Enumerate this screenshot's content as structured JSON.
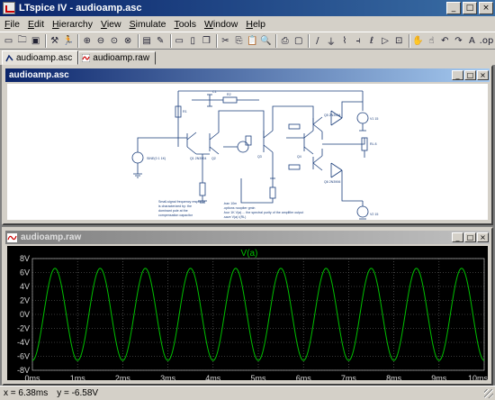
{
  "app": {
    "title": "LTspice IV - audioamp.asc",
    "window_buttons": [
      "_",
      "□",
      "×"
    ]
  },
  "menu": [
    {
      "accel": "F",
      "rest": "ile"
    },
    {
      "accel": "E",
      "rest": "dit"
    },
    {
      "accel": "H",
      "rest": "ierarchy"
    },
    {
      "accel": "V",
      "rest": "iew"
    },
    {
      "accel": "S",
      "rest": "imulate"
    },
    {
      "accel": "T",
      "rest": "ools"
    },
    {
      "accel": "W",
      "rest": "indow"
    },
    {
      "accel": "H",
      "rest": "elp"
    }
  ],
  "toolbar": {
    "icons": [
      "open-icon",
      "folder-icon",
      "save-icon",
      "sep",
      "settings-icon",
      "run-icon",
      "sep",
      "zoom-in-icon",
      "zoom-out-icon",
      "zoom-fit-icon",
      "zoom-cancel-icon",
      "sep",
      "autorange-icon",
      "probe-icon",
      "sep",
      "tile-horizontal-icon",
      "tile-vertical-icon",
      "cascade-icon",
      "sep",
      "cut-icon",
      "copy-icon",
      "paste-icon",
      "find-icon",
      "sep",
      "print-icon",
      "print-preview-icon",
      "sep",
      "wire-icon",
      "ground-icon",
      "resistor-icon",
      "capacitor-icon",
      "inductor-icon",
      "diode-icon",
      "component-icon",
      "sep",
      "move-icon",
      "drag-icon",
      "undo-icon",
      "redo-icon",
      "text-icon",
      "spice-directive-icon"
    ],
    "glyphs": {
      "open-icon": "▭",
      "folder-icon": "🗀",
      "save-icon": "▣",
      "settings-icon": "⚒",
      "run-icon": "🏃",
      "zoom-in-icon": "⊕",
      "zoom-out-icon": "⊖",
      "zoom-fit-icon": "⊙",
      "zoom-cancel-icon": "⊗",
      "autorange-icon": "▤",
      "probe-icon": "✎",
      "tile-horizontal-icon": "▭",
      "tile-vertical-icon": "▯",
      "cascade-icon": "❐",
      "cut-icon": "✂",
      "copy-icon": "⎘",
      "paste-icon": "📋",
      "find-icon": "🔍",
      "print-icon": "⎙",
      "print-preview-icon": "▢",
      "wire-icon": "/",
      "ground-icon": "⏚",
      "resistor-icon": "⌇",
      "capacitor-icon": "⫞",
      "inductor-icon": "ℓ",
      "diode-icon": "▷",
      "component-icon": "⊡",
      "move-icon": "✋",
      "drag-icon": "☝",
      "undo-icon": "↶",
      "redo-icon": "↷",
      "text-icon": "A",
      "spice-directive-icon": ".op"
    }
  },
  "tabs": [
    {
      "label": "audioamp.asc",
      "active": true
    },
    {
      "label": "audioamp.raw",
      "active": false
    }
  ],
  "schematic_window": {
    "title": "audioamp.asc"
  },
  "waveform_window": {
    "title": "audioamp.raw",
    "trace_label": "V(a)"
  },
  "chart_data": {
    "type": "line",
    "title": "V(a)",
    "xlabel": "",
    "ylabel": "",
    "x_ticks": [
      "0ms",
      "1ms",
      "2ms",
      "3ms",
      "4ms",
      "5ms",
      "6ms",
      "7ms",
      "8ms",
      "9ms",
      "10ms"
    ],
    "y_ticks": [
      "8V",
      "6V",
      "4V",
      "2V",
      "0V",
      "-2V",
      "-4V",
      "-6V",
      "-8V"
    ],
    "xlim": [
      0,
      10
    ],
    "ylim": [
      -8,
      8
    ],
    "grid": true,
    "series": [
      {
        "name": "V(a)",
        "color": "#00c000",
        "amplitude": 6.6,
        "frequency_khz": 1.0,
        "phase_deg": 180
      }
    ],
    "background": "#000000"
  },
  "status": {
    "x": "x = 6.38ms",
    "y": "y = -6.58V"
  },
  "colors": {
    "title_active": "#0a246a",
    "trace": "#00c000",
    "grid": "#808080"
  }
}
